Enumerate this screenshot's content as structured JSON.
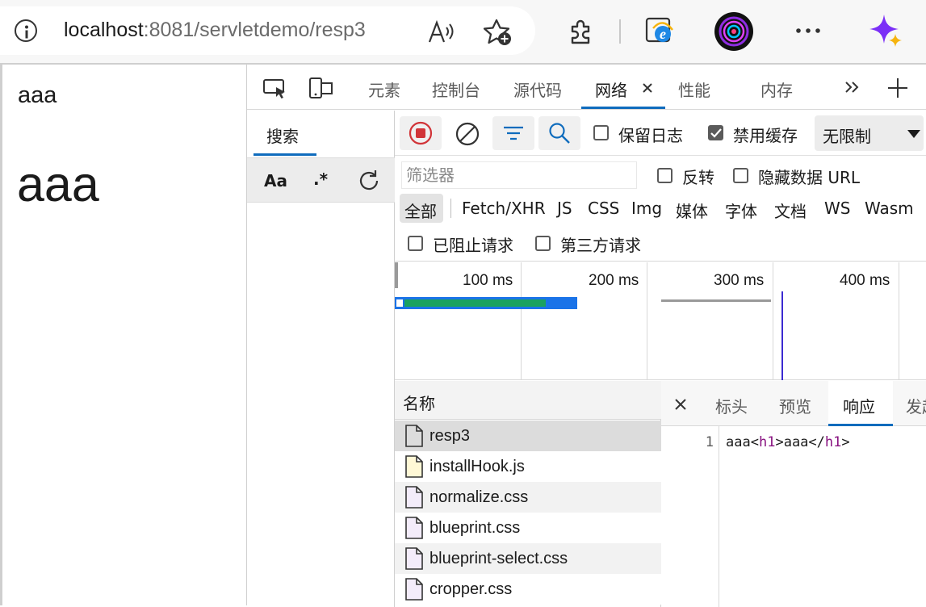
{
  "browser": {
    "url_host": "localhost",
    "url_rest": ":8081/servletdemo/resp3"
  },
  "page": {
    "text_small": "aaa",
    "heading": "aaa"
  },
  "devtools": {
    "tabs": [
      "元素",
      "控制台",
      "源代码",
      "网络",
      "性能",
      "内存"
    ],
    "active_tab": "网络",
    "search_tab": "搜索",
    "search_case": "Aa",
    "search_regex": ".*",
    "toolbar": {
      "preserve_log": "保留日志",
      "preserve_log_checked": false,
      "disable_cache": "禁用缓存",
      "disable_cache_checked": true,
      "throttle": "无限制"
    },
    "filter": {
      "placeholder": "筛选器",
      "invert": "反转",
      "hide_data_urls": "隐藏数据 URL",
      "types": [
        "全部",
        "Fetch/XHR",
        "JS",
        "CSS",
        "Img",
        "媒体",
        "字体",
        "文档",
        "WS",
        "Wasm"
      ],
      "blocked_requests": "已阻止请求",
      "third_party": "第三方请求"
    },
    "timeline": {
      "labels": [
        "100 ms",
        "200 ms",
        "300 ms",
        "400 ms"
      ]
    },
    "requests": {
      "header": "名称",
      "items": [
        "resp3",
        "installHook.js",
        "normalize.css",
        "blueprint.css",
        "blueprint-select.css",
        "cropper.css"
      ]
    },
    "details": {
      "tabs": [
        "标头",
        "预览",
        "响应",
        "发起"
      ],
      "active": "响应",
      "line_number": "1",
      "code": {
        "pre": "aaa",
        "open_lt": "<",
        "open_tag": "h1",
        "open_gt": ">",
        "mid": "aaa",
        "close_lt": "</",
        "close_tag": "h1",
        "close_gt": ">"
      }
    }
  }
}
